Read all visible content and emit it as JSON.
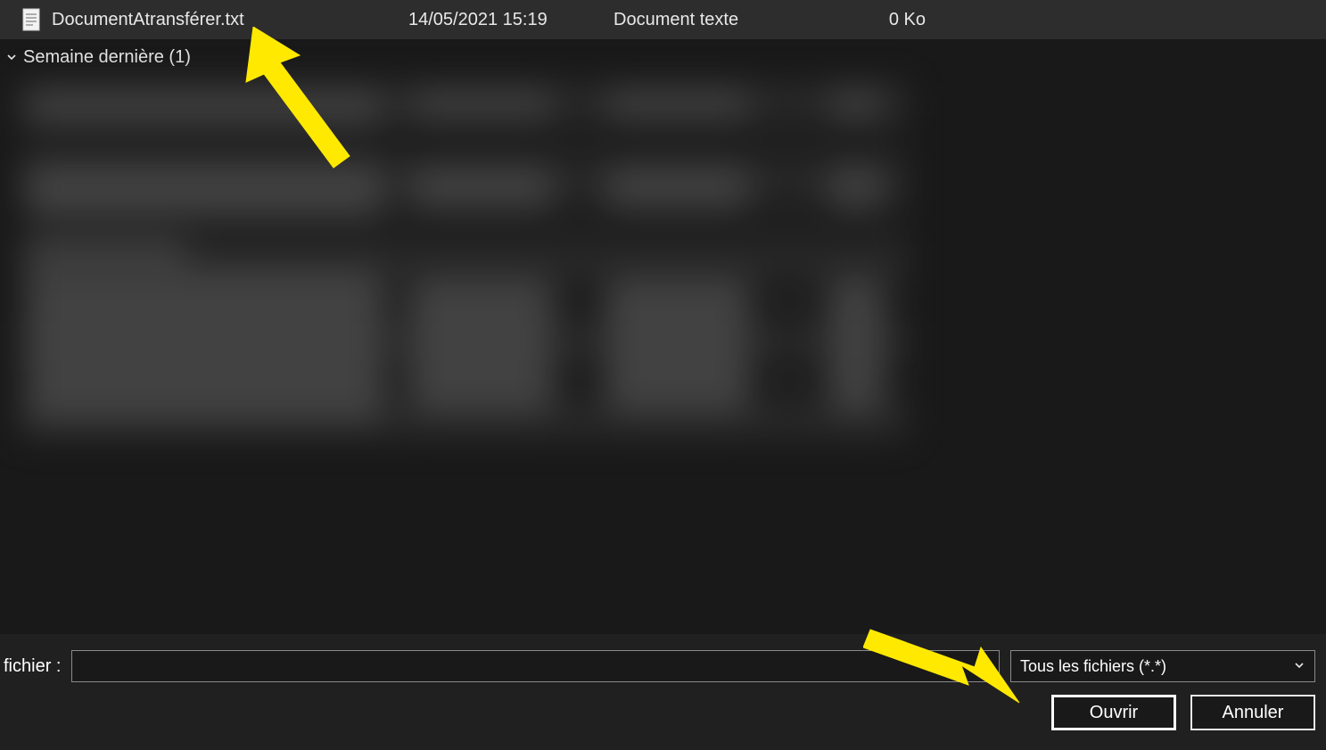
{
  "file_row": {
    "name": "DocumentAtransférer.txt",
    "date": "14/05/2021 15:19",
    "type": "Document texte",
    "size": "0 Ko"
  },
  "group_header": "Semaine dernière (1)",
  "bottom": {
    "filename_label": "fichier :",
    "filename_value": "",
    "filetype_selected": "Tous les fichiers (*.*)",
    "open_label": "Ouvrir",
    "cancel_label": "Annuler"
  }
}
